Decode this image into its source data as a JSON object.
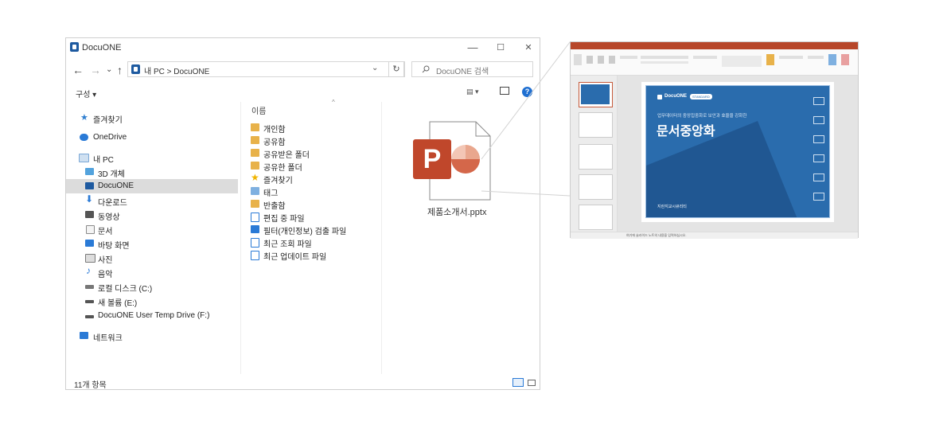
{
  "explorer": {
    "title": "DocuONE",
    "controls": {
      "minimize": "—",
      "maximize": "☐",
      "close": "✕"
    },
    "nav": {
      "back": "←",
      "forward": "→",
      "dropdown": "⌄",
      "up": "↑"
    },
    "address": "내 PC  >  DocuONE",
    "address_parts": [
      "내 PC",
      "DocuONE"
    ],
    "search_placeholder": "DocuONE 검색",
    "toolbar_left": "구성 ▾",
    "help": "?",
    "sidebar": [
      {
        "label": "즐겨찾기",
        "icon": "star-icon",
        "color": "#2f7fd0"
      },
      {
        "label": "OneDrive",
        "icon": "cloud-icon",
        "color": "#2a7ad6"
      },
      {
        "label": "내 PC",
        "icon": "computer-icon",
        "color": "#7aa7d6"
      },
      {
        "label": "3D 개체",
        "icon": "cube-icon",
        "color": "#53a3dd"
      },
      {
        "label": "DocuONE",
        "icon": "docuone-icon",
        "color": "#1e5aa0"
      },
      {
        "label": "다운로드",
        "icon": "download-icon",
        "color": "#2a7ad6"
      },
      {
        "label": "동영상",
        "icon": "video-icon",
        "color": "#555555"
      },
      {
        "label": "문서",
        "icon": "document-icon",
        "color": "#8a8a8a"
      },
      {
        "label": "바탕 화면",
        "icon": "desktop-icon",
        "color": "#2a7ad6"
      },
      {
        "label": "사진",
        "icon": "picture-icon",
        "color": "#7a7a7a"
      },
      {
        "label": "음악",
        "icon": "music-icon",
        "color": "#2a7ad6"
      },
      {
        "label": "로컬 디스크 (C:)",
        "icon": "disk-icon",
        "color": "#777777"
      },
      {
        "label": "새 볼륨 (E:)",
        "icon": "drive-icon",
        "color": "#555555"
      },
      {
        "label": "DocuONE User Temp Drive (F:)",
        "icon": "drive-icon",
        "color": "#555555"
      },
      {
        "label": "네트워크",
        "icon": "network-icon",
        "color": "#2a7ad6"
      }
    ],
    "column_header": "이름",
    "files": [
      {
        "label": "개인함",
        "icon": "folder-icon"
      },
      {
        "label": "공유함",
        "icon": "shared-folder-icon"
      },
      {
        "label": "공유받은 폴더",
        "icon": "shared-folder-icon"
      },
      {
        "label": "공유한 폴더",
        "icon": "shared-folder-icon"
      },
      {
        "label": "즐겨찾기",
        "icon": "star-icon"
      },
      {
        "label": "태그",
        "icon": "tag-icon"
      },
      {
        "label": "반출함",
        "icon": "folder-icon"
      },
      {
        "label": "편집 중 파일",
        "icon": "lock-file-icon"
      },
      {
        "label": "필터(개인정보) 검출 파일",
        "icon": "filter-file-icon"
      },
      {
        "label": "최근 조회 파일",
        "icon": "search-file-icon"
      },
      {
        "label": "최근 업데이트 파일",
        "icon": "update-file-icon"
      }
    ],
    "preview_file": "제품소개서.pptx",
    "status": "11개 항목",
    "colors": {
      "accent": "#1e5aa0",
      "ppt": "#c0472b",
      "selection": "#dcdcdc"
    }
  },
  "slide": {
    "brand": "DocuONE",
    "badge": "STANDARD",
    "subtitle": "업무데이터의 중앙집중화로 보안과 효율을 강화한",
    "title": "문서중앙화",
    "footer_logo": "지란지교시큐리티",
    "status_note": "여기에 슬라이드 노트의 내용을 입력하십시오.",
    "colors": {
      "blue": "#2a6cad",
      "dark": "#1d4f86",
      "titlebar": "#b7472a"
    }
  }
}
